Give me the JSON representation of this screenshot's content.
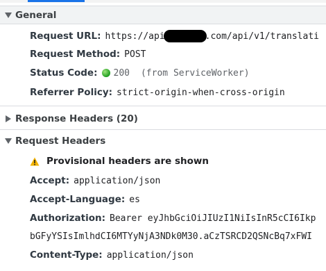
{
  "general": {
    "title": "General",
    "request_url": {
      "label": "Request URL:",
      "value_prefix": "https://api",
      "value_suffix": ".com/api/v1/translati"
    },
    "request_method": {
      "label": "Request Method:",
      "value": "POST"
    },
    "status_code": {
      "label": "Status Code:",
      "code": "200",
      "note": "(from ServiceWorker)",
      "status_color": "#1e9e1e"
    },
    "referrer_policy": {
      "label": "Referrer Policy:",
      "value": "strict-origin-when-cross-origin"
    }
  },
  "response_headers": {
    "title": "Response Headers (20)",
    "expanded": false
  },
  "request_headers": {
    "title": "Request Headers",
    "expanded": true,
    "warning": {
      "icon": "warning-icon",
      "text": "Provisional headers are shown",
      "color": "#f2b300"
    },
    "items": [
      {
        "label": "Accept:",
        "value": "application/json"
      },
      {
        "label": "Accept-Language:",
        "value": "es"
      },
      {
        "label": "Authorization:",
        "value": "Bearer eyJhbGciOiJIUzI1NiIsInR5cCI6Ikp",
        "cont": "bGFyYSIsImlhdCI6MTYyNjA3NDk0M30.aCzTSRCD2QSNcBq7xFWI"
      },
      {
        "label": "Content-Type:",
        "value": "application/json"
      }
    ]
  }
}
